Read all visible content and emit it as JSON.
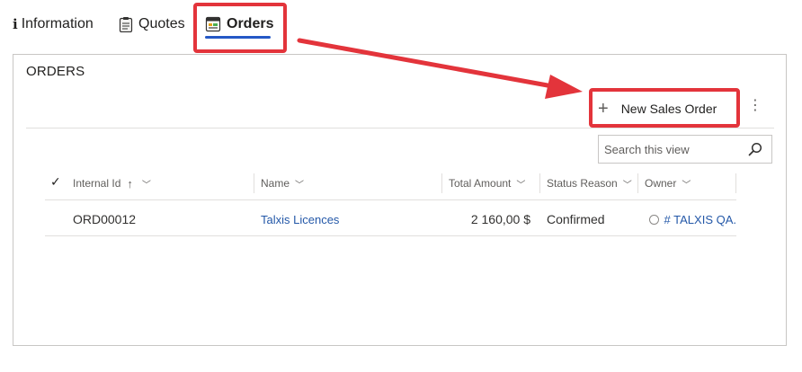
{
  "tabs": [
    {
      "label": "Information",
      "icon": "info-icon"
    },
    {
      "label": "Quotes",
      "icon": "clipboard-icon"
    },
    {
      "label": "Orders",
      "icon": "orders-form-icon",
      "active": true
    }
  ],
  "panel": {
    "title": "ORDERS",
    "new_button_label": "New Sales Order",
    "more_icon": "more-vertical-icon",
    "search_placeholder": "Search this view"
  },
  "grid": {
    "columns": [
      {
        "label": "Internal Id",
        "sort": "ascending"
      },
      {
        "label": "Name"
      },
      {
        "label": "Total Amount"
      },
      {
        "label": "Status Reason"
      },
      {
        "label": "Owner"
      }
    ],
    "rows": [
      {
        "internal_id": "ORD00012",
        "name": "Talxis Licences",
        "total_amount": "2 160,00 $",
        "status_reason": "Confirmed",
        "owner": "# TALXIS QA."
      }
    ]
  },
  "colors": {
    "accent": "#2458c6",
    "highlight": "#e3343b",
    "arrow": "#e3343b",
    "link": "#2458a8"
  }
}
